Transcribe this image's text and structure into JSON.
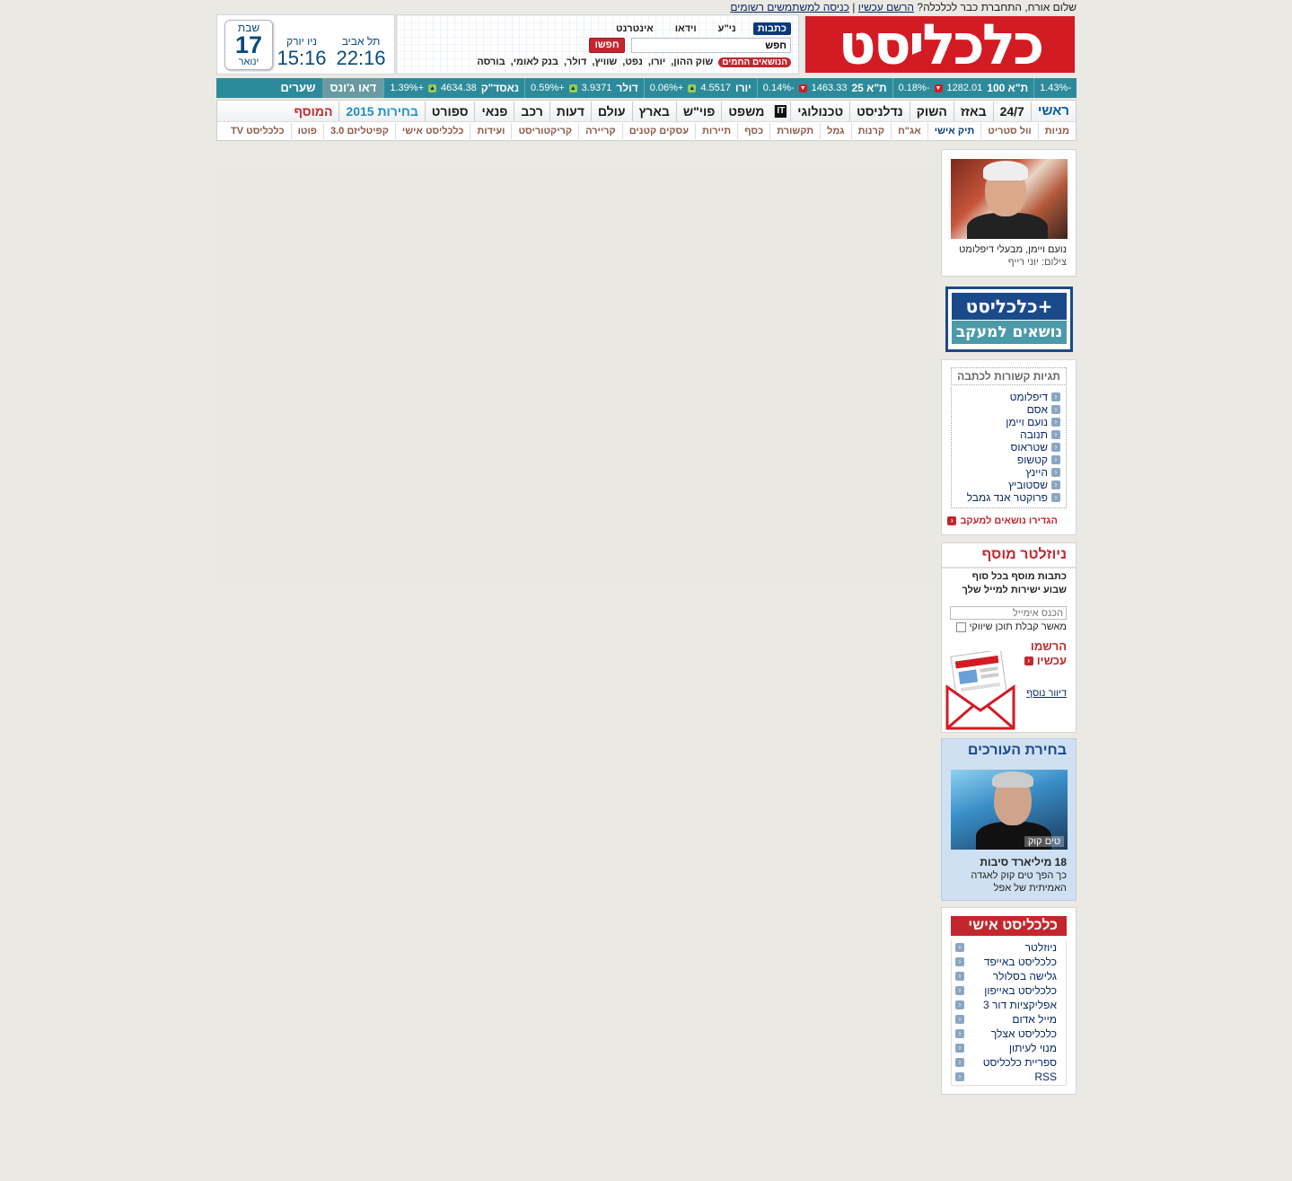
{
  "greeting": {
    "text": "שלום אורח, התחברת כבר לכלכלה?",
    "register_link": "הרשם עכשיו",
    "separator": "|",
    "login_link": "כניסה למשתמשים רשומים"
  },
  "logo": {
    "text": "כלכליסט"
  },
  "search": {
    "tabs": [
      "כתבות",
      "ני\"ע",
      "וידאו",
      "אינטרנט"
    ],
    "active_tab": "כתבות",
    "input_value": "חפש",
    "button_label": "חפשו",
    "hot_label": "הנושאים החמים",
    "hot_topics": [
      "שוק ההון,",
      "יורו,",
      "נפט,",
      "שוויץ,",
      "דולר,",
      "בנק לאומי,",
      "בורסה"
    ]
  },
  "clock": {
    "day_name": "שבת",
    "day_number": "17",
    "month": "ינואר",
    "cities": [
      {
        "city": "תל אביב",
        "time": "22:16"
      },
      {
        "city": "ניו יורק",
        "time": "15:16"
      }
    ]
  },
  "ticker": {
    "items": [
      {
        "value": "-1.43%",
        "direction": "down"
      },
      {
        "name": "ת\"א 100",
        "value": "1282.01",
        "change": "-0.18%",
        "direction": "down"
      },
      {
        "name": "ת\"א 25",
        "value": "1463.33",
        "change": "-0.14%",
        "direction": "down"
      },
      {
        "name": "יורו",
        "value": "4.5517",
        "change": "+0.06%",
        "direction": "up"
      },
      {
        "name": "דולר",
        "value": "3.9371",
        "change": "+0.59%",
        "direction": "up"
      },
      {
        "name": "נאסד\"ק",
        "value": "4634.38",
        "change": "+1.39%",
        "direction": "up"
      }
    ],
    "label_dow": "דאו ג'ונס",
    "label_rates": "שערים"
  },
  "nav": {
    "main": [
      "ראשי",
      "24/7",
      "באזז",
      "השוק",
      "נדלניסט",
      "טכנולוגי",
      "IT",
      "משפט",
      "פוי\"ש",
      "בארץ",
      "עולם",
      "דעות",
      "רכב",
      "פנאי",
      "ספורט",
      "בחירות 2015",
      "המוסף"
    ],
    "sub": [
      "מניות",
      "וול סטריט",
      "תיק אישי",
      "אג\"ח",
      "קרנות",
      "גמל",
      "תקשורת",
      "כסף",
      "תיירות",
      "עסקים קטנים",
      "קריירה",
      "קריקטוריסט",
      "ועידות",
      "כלכליסט אישי",
      "קפיטליזם 3.0",
      "פוטו",
      "כלכליסט TV"
    ],
    "sub_selected": "תיק אישי"
  },
  "photo": {
    "caption": "נועם ויימן, מבעלי דיפלומט",
    "credit": "צילום: יוני רייף"
  },
  "plus_banner": {
    "top": "כלכליסט+",
    "bottom": "נושאים למעקב"
  },
  "tags": {
    "title": "תגיות קשורות לכתבה",
    "items": [
      "דיפלומט",
      "אסם",
      "נועם ויימן",
      "תנובה",
      "שטראוס",
      "קטשופ",
      "היינץ",
      "שסטוביץ",
      "פרוקטר אנד גמבל"
    ],
    "follow_label": "הגדירו נושאים למעקב"
  },
  "newsletter": {
    "title": "ניוזלטר מוסף",
    "line1": "כתבות מוסף בכל סוף",
    "line2": "שבוע ישירות למייל שלך",
    "email_placeholder": "הכנס אימייל",
    "consent": "מאשר קבלת תוכן שיווקי",
    "register_line1": "הרשמו",
    "register_line2": "עכשיו",
    "mail_link": "דיוור נוסף"
  },
  "editors_pick": {
    "title": "בחירת העורכים",
    "photo_caption": "טים קוק",
    "headline": "18 מיליארד סיבות",
    "sub": "כך הפך טים קוק לאגדה האמיתית של אפל"
  },
  "personal": {
    "title": "כלכליסט אישי",
    "items": [
      "ניוזלטר",
      "כלכליסט באייפד",
      "גלישה בסלולר",
      "כלכליסט באייפון",
      "אפליקציות דור 3",
      "מייל אדום",
      "כלכליסט אצלך",
      "מנוי לעיתון",
      "ספריית כלכליסט",
      "RSS"
    ]
  },
  "colors": {
    "brand_red": "#d31b24",
    "navy": "#0b3a7a",
    "ticker_teal": "#2d8a9a",
    "page_bg": "#ebe9e3"
  }
}
